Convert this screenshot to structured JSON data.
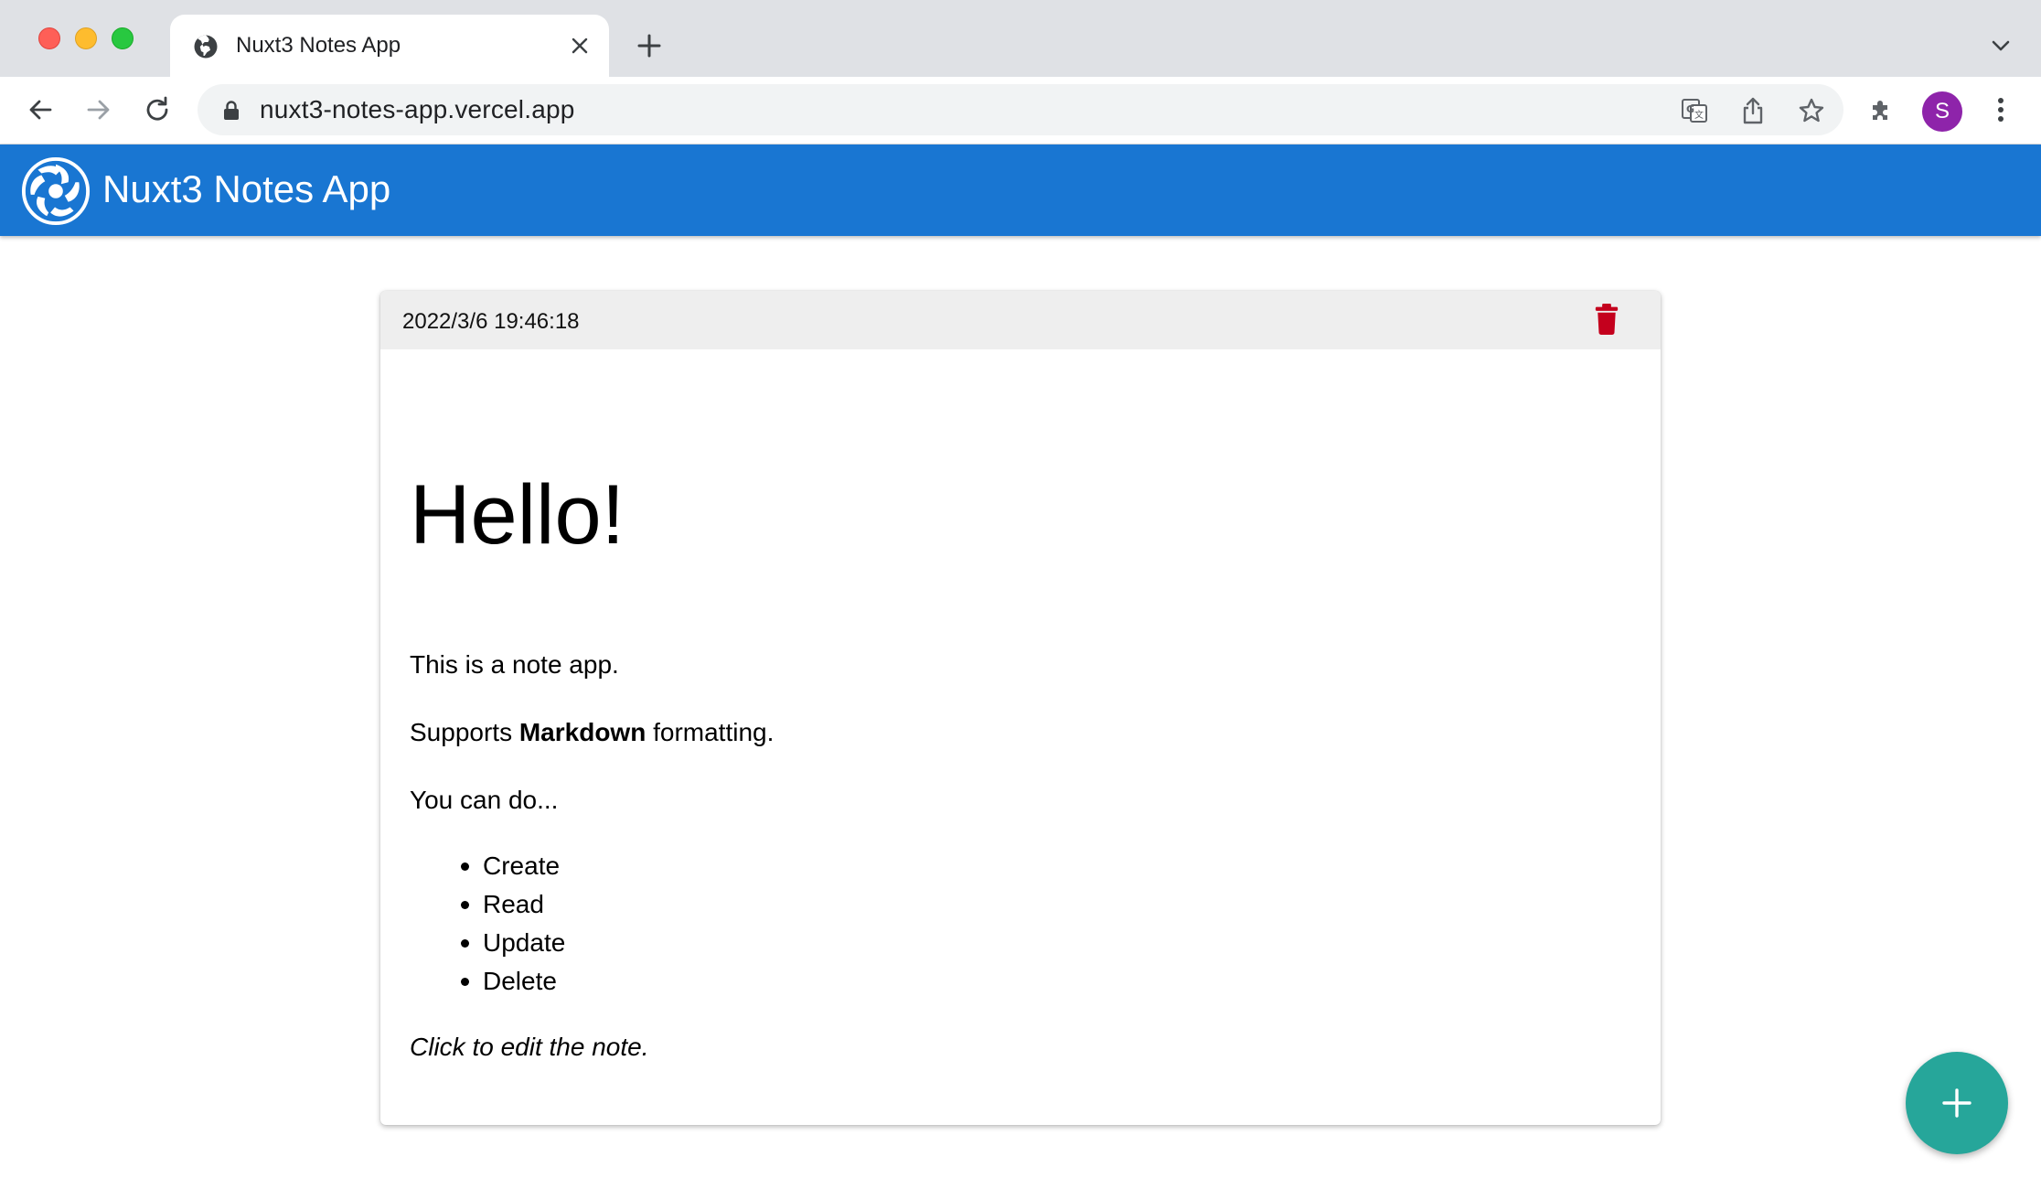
{
  "browser": {
    "tab_title": "Nuxt3 Notes App",
    "url": "nuxt3-notes-app.vercel.app",
    "avatar_initial": "S"
  },
  "app": {
    "title": "Nuxt3 Notes App",
    "accent_color": "#1976d2",
    "fab_color": "#26a69a"
  },
  "note": {
    "timestamp": "2022/3/6 19:46:18",
    "heading": "Hello!",
    "paragraph1": "This is a note app.",
    "paragraph2_prefix": "Supports ",
    "paragraph2_bold": "Markdown",
    "paragraph2_suffix": " formatting.",
    "paragraph3": "You can do...",
    "list": [
      "Create",
      "Read",
      "Update",
      "Delete"
    ],
    "footer_italic": "Click to edit the note."
  },
  "icons": {
    "delete": "trash-icon",
    "fab": "plus-icon"
  }
}
